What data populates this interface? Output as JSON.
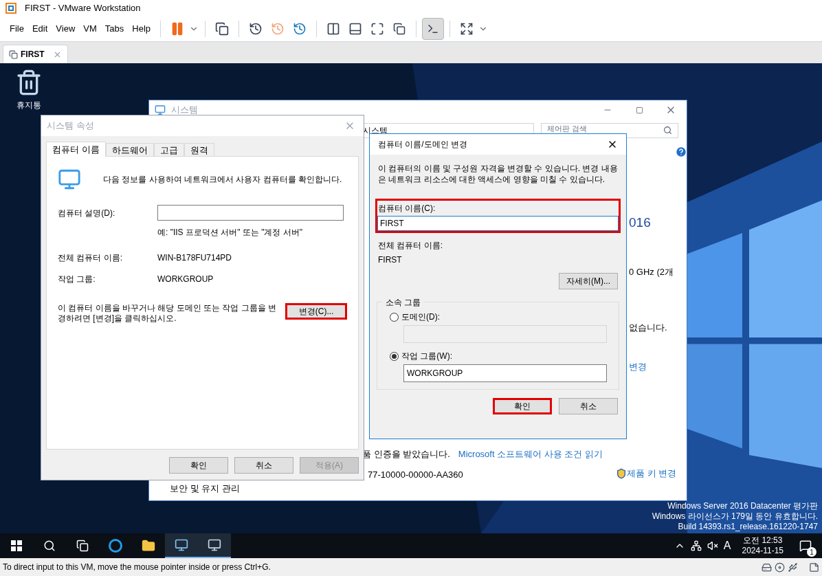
{
  "window": {
    "title": "FIRST - VMware Workstation"
  },
  "menu": [
    "File",
    "Edit",
    "View",
    "VM",
    "Tabs",
    "Help"
  ],
  "toolbar": [
    {
      "kind": "pause",
      "selected": false
    },
    {
      "kind": "dropdown",
      "selected": false
    },
    {
      "kind": "send-keys",
      "selected": false
    },
    {
      "kind": "snapshot-take",
      "selected": false
    },
    {
      "kind": "snapshot-revert",
      "selected": false
    },
    {
      "kind": "snapshot-manager",
      "selected": false
    },
    {
      "kind": "library",
      "selected": false
    },
    {
      "kind": "thumbnail",
      "selected": false
    },
    {
      "kind": "fullscreen",
      "selected": false
    },
    {
      "kind": "unity",
      "selected": false
    },
    {
      "kind": "console",
      "selected": true
    },
    {
      "kind": "stretch",
      "selected": false
    },
    {
      "kind": "dropdown",
      "selected": false
    }
  ],
  "tabs": [
    {
      "label": "FIRST",
      "selected": true
    }
  ],
  "desktop": {
    "icons": [
      {
        "label": "휴지통"
      }
    ],
    "os_notice": [
      "Windows Server 2016 Datacenter 평가판",
      "Windows 라이선스가 179일 동안 유효합니다.",
      "Build 14393.rs1_release.161220-1747"
    ]
  },
  "system_window": {
    "title": "시스템",
    "address": "시스템",
    "search_placeholder": "제어판 검색",
    "fragments": [
      {
        "kind": "heading",
        "text": "016"
      },
      {
        "kind": "text",
        "text": "0 GHz (2개"
      },
      {
        "kind": "text",
        "text": "없습니다."
      },
      {
        "kind": "link",
        "text": "변경"
      }
    ],
    "activation_text": "품 인증을 받았습니다.",
    "license_link": "Microsoft 소프트웨어 사용 조건 읽기",
    "product_id": "77-10000-00000-AA360",
    "product_key_link": "제품 키 변경",
    "see_also": "보안 및 유지 관리"
  },
  "system_properties": {
    "title": "시스템 속성",
    "tabs": [
      {
        "label": "컴퓨터 이름",
        "selected": true
      },
      {
        "label": "하드웨어",
        "selected": false
      },
      {
        "label": "고급",
        "selected": false
      },
      {
        "label": "원격",
        "selected": false
      }
    ],
    "intro": "다음 정보를 사용하여 네트워크에서 사용자 컴퓨터를 확인합니다.",
    "description_label": "컴퓨터 설명(D):",
    "description_hint": "예: \"IIS 프로덕션 서버\" 또는 \"계정 서버\"",
    "full_name_label": "전체 컴퓨터 이름:",
    "full_name": "WIN-B178FU714PD",
    "workgroup_label": "작업 그룹:",
    "workgroup": "WORKGROUP",
    "change_text": "이 컴퓨터 이름을 바꾸거나 해당 도메인 또는 작업 그룹을 변경하려면 [변경]을 클릭하십시오.",
    "change_button": {
      "label": "변경(C)...",
      "highlighted": true
    },
    "buttons": [
      {
        "label": "확인",
        "disabled": false
      },
      {
        "label": "취소",
        "disabled": false
      },
      {
        "label": "적용(A)",
        "disabled": true
      }
    ]
  },
  "change_dialog": {
    "title": "컴퓨터 이름/도메인 변경",
    "description": "이 컴퓨터의 이름 및 구성원 자격을 변경할 수 있습니다. 변경 내용은 네트워크 리소스에 대한 액세스에 영향을 미칠 수 있습니다.",
    "name_label": "컴퓨터 이름(C):",
    "name_value": "FIRST",
    "name_highlighted": true,
    "full_label": "전체 컴퓨터 이름:",
    "full_value": "FIRST",
    "more_button": "자세히(M)...",
    "group_title": "소속 그룹",
    "options": [
      {
        "label": "도메인(D):",
        "selected": false
      },
      {
        "label": "작업 그룹(W):",
        "selected": true,
        "value": "WORKGROUP"
      }
    ],
    "buttons": [
      {
        "label": "확인",
        "highlighted": true
      },
      {
        "label": "취소",
        "highlighted": false
      }
    ]
  },
  "taskbar": {
    "apps": [
      {
        "kind": "search",
        "running": false
      },
      {
        "kind": "task-view",
        "running": false
      },
      {
        "kind": "browser",
        "running": false
      },
      {
        "kind": "folder",
        "running": false
      },
      {
        "kind": "server-manager",
        "running": true
      },
      {
        "kind": "system",
        "running": true
      }
    ],
    "ime": "A",
    "time": "오전 12:53",
    "date": "2024-11-15",
    "notifications": "1"
  },
  "status_bar": {
    "text": "To direct input to this VM, move the mouse pointer inside or press Ctrl+G."
  }
}
